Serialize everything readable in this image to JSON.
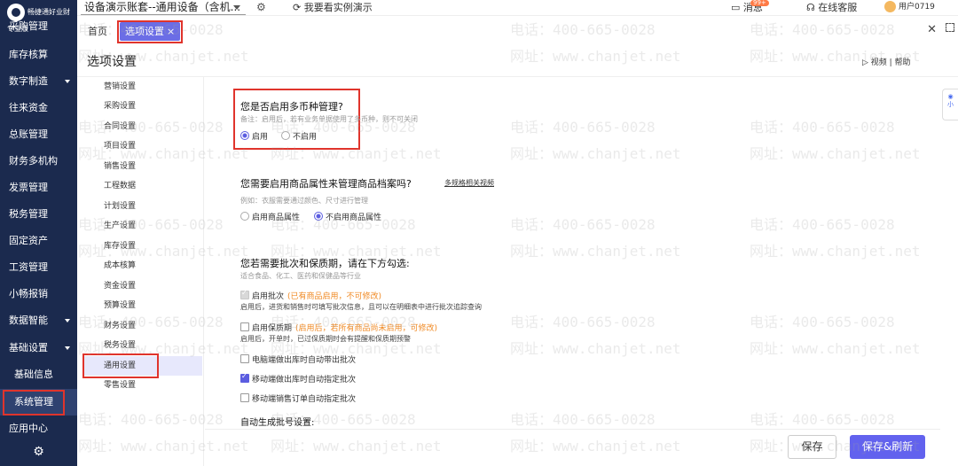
{
  "sidebar": {
    "brand": "畅捷通好业财",
    "edition": "专业版",
    "items": [
      {
        "label": "采购管理"
      },
      {
        "label": "库存核算"
      },
      {
        "label": "数字制造"
      },
      {
        "label": "往来资金"
      },
      {
        "label": "总账管理"
      },
      {
        "label": "财务多机构"
      },
      {
        "label": "发票管理"
      },
      {
        "label": "税务管理"
      },
      {
        "label": "固定资产"
      },
      {
        "label": "工资管理"
      },
      {
        "label": "小畅报销"
      },
      {
        "label": "数据智能"
      },
      {
        "label": "基础设置"
      },
      {
        "label": "基础信息"
      },
      {
        "label": "系统管理"
      },
      {
        "label": "应用中心"
      }
    ],
    "settings_icon": "gear-icon"
  },
  "topbar": {
    "account": "设备演示账套--通用设备（含机...",
    "demo": "我要看实例演示",
    "message": "消息",
    "badge": "99+",
    "service": "在线客服",
    "user": "用户0719"
  },
  "tabs": {
    "home": "首页",
    "options": "选项设置",
    "close_glyph": "×"
  },
  "page": {
    "title": "选项设置",
    "tools": "视频 | 帮助"
  },
  "settings_nav": [
    "营销设置",
    "采购设置",
    "合同设置",
    "项目设置",
    "销售设置",
    "工程数据",
    "计划设置",
    "生产设置",
    "库存设置",
    "成本核算",
    "资金设置",
    "预算设置",
    "财务设置",
    "税务设置",
    "通用设置",
    "零售设置"
  ],
  "content": {
    "multi_currency": {
      "question": "您是否启用多币种管理?",
      "note": "备注：启用后，若有业务单据使用了多币种，则不可关闭",
      "opt_on": "启用",
      "opt_off": "不启用"
    },
    "product_attr": {
      "question": "您需要启用商品属性来管理商品档案吗?",
      "link": "多规格相关视频",
      "note": "例如：衣服需要通过颜色、尺寸进行管理",
      "opt_on": "启用商品属性",
      "opt_off": "不启用商品属性"
    },
    "batch": {
      "question": "您若需要批次和保质期，请在下方勾选:",
      "note": "适合食品、化工、医药和保健品等行业",
      "batch_label": "启用批次",
      "batch_hint": "(已有商品启用，不可修改)",
      "batch_note": "启用后，进货和销售时可填写批次信息，且可以在明细表中进行批次追踪查询",
      "shelf_label": "启用保质期",
      "shelf_hint": "(启用后，若所有商品尚未启用，可修改)",
      "shelf_note": "启用后，开单时，已过保质期时会有提醒和保质期预警",
      "pc_auto": "电脑端做出库时自动带出批次",
      "mobile_auto": "移动端做出库时自动指定批次",
      "mobile_order": "移动端销售订单自动指定批次"
    },
    "auto_batch": "自动生成批号设置:"
  },
  "footer": {
    "save": "保存",
    "save_refresh": "保存&刷新"
  },
  "side_widget": "小",
  "watermark": {
    "phone": "电话：400-665-0028",
    "url": "网址：www.chanjet.net"
  },
  "colors": {
    "sidebar_bg": "#1b2a4e",
    "accent": "#6262ee",
    "highlight_box": "#e0342c",
    "hint_orange": "#f08a24"
  }
}
